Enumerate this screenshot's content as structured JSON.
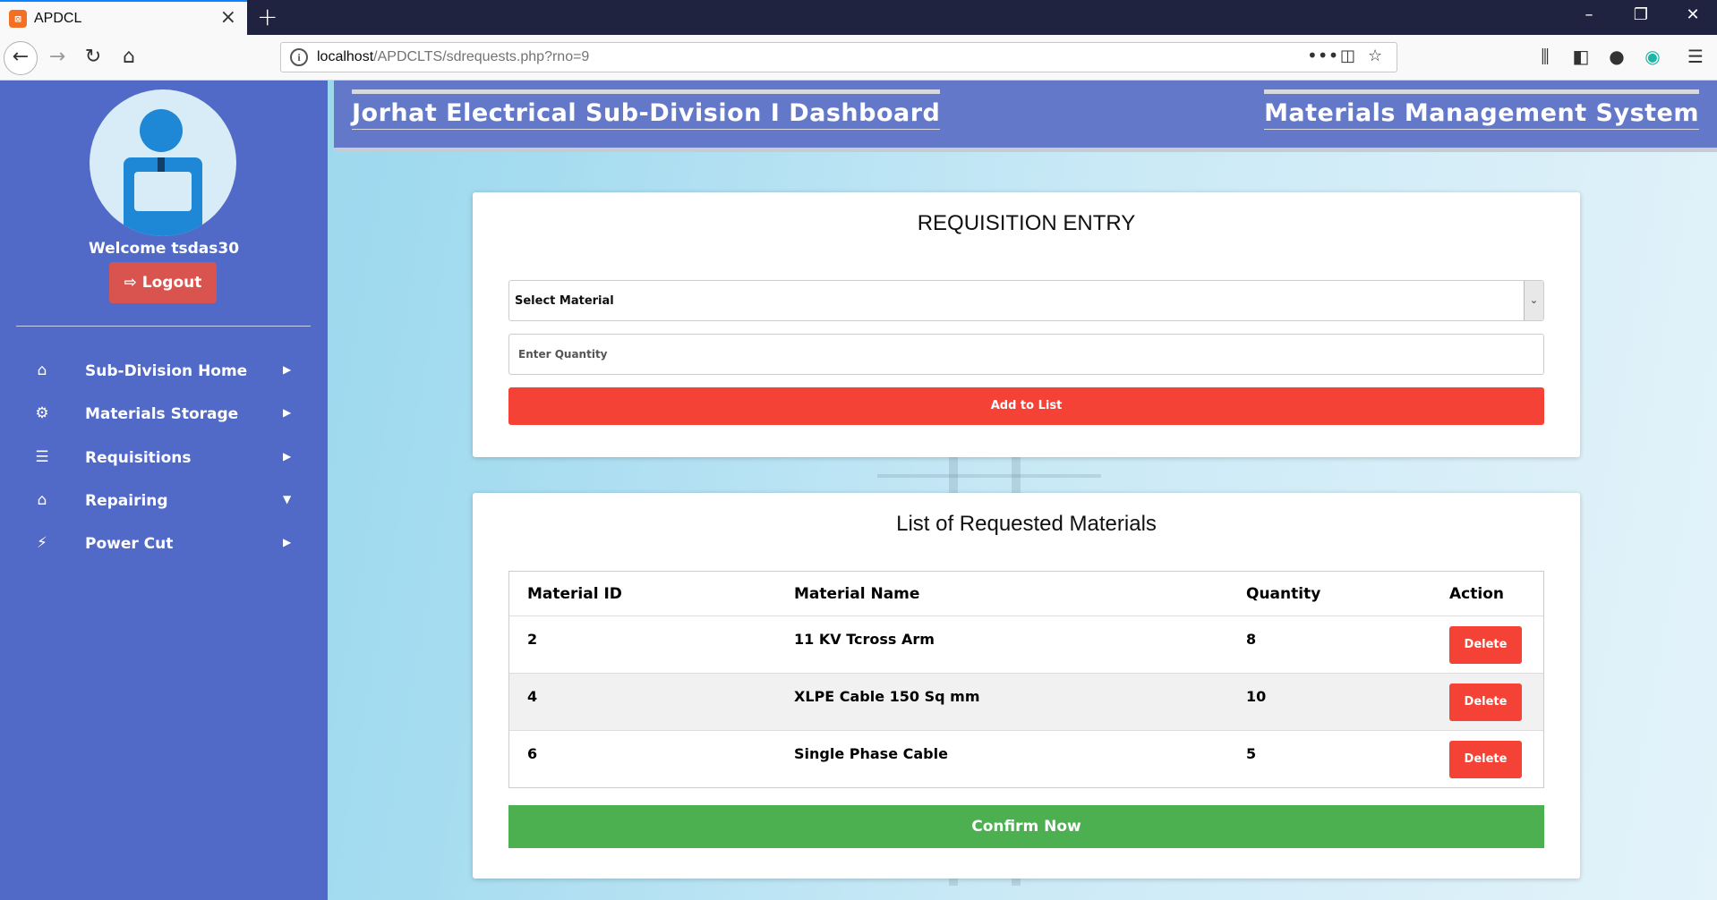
{
  "browser": {
    "tab_title": "APDCL",
    "tab_icon": "xampp-icon",
    "url_host": "localhost",
    "url_rest": "/APDCLTS/sdrequests.php?rno=9"
  },
  "header": {
    "left_title": "Jorhat Electrical Sub-Division I Dashboard",
    "right_title": "Materials Management System"
  },
  "sidebar": {
    "welcome": "Welcome tsdas30",
    "logout_label": "Logout",
    "items": [
      {
        "label": "Sub-Division Home",
        "icon": "home-icon",
        "arrow": "right"
      },
      {
        "label": "Materials Storage",
        "icon": "gear-icon",
        "arrow": "right"
      },
      {
        "label": "Requisitions",
        "icon": "list-icon",
        "arrow": "right"
      },
      {
        "label": "Repairing",
        "icon": "bank-icon",
        "arrow": "down"
      },
      {
        "label": "Power Cut",
        "icon": "plug-icon",
        "arrow": "right"
      }
    ]
  },
  "entry": {
    "title": "REQUISITION ENTRY",
    "select_value": "Select Material",
    "quantity_placeholder": "Enter Quantity",
    "add_label": "Add to List"
  },
  "list": {
    "title": "List of Requested Materials",
    "columns": [
      "Material ID",
      "Material Name",
      "Quantity",
      "Action"
    ],
    "rows": [
      {
        "id": "2",
        "name": "11 KV Tcross Arm",
        "qty": "8",
        "action": "Delete"
      },
      {
        "id": "4",
        "name": "XLPE Cable 150 Sq mm",
        "qty": "10",
        "action": "Delete"
      },
      {
        "id": "6",
        "name": "Single Phase Cable",
        "qty": "5",
        "action": "Delete"
      }
    ],
    "confirm_label": "Confirm Now"
  },
  "colors": {
    "sidebar": "#5169c7",
    "header": "#6478c9",
    "danger": "#f44336",
    "success": "#4caf50",
    "logout": "#d9534f"
  }
}
